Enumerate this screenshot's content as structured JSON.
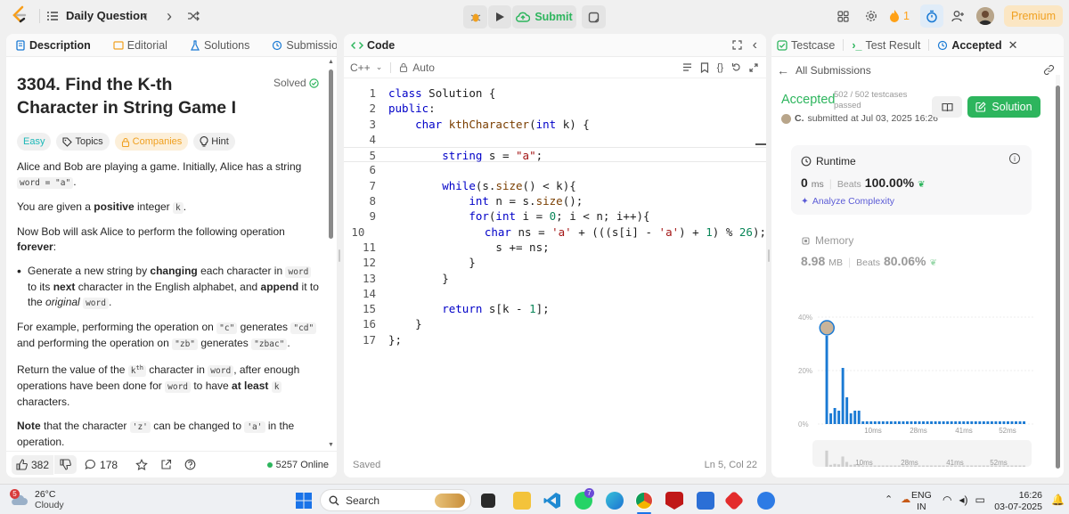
{
  "topbar": {
    "title": "Daily Question",
    "submit_label": "Submit",
    "streak": "1",
    "premium_label": "Premium"
  },
  "left": {
    "tabs": [
      "Description",
      "Editorial",
      "Solutions",
      "Submissions"
    ],
    "problem_title": "3304. Find the K-th Character in String Game I",
    "solved_label": "Solved",
    "tags": [
      "Easy",
      "Topics",
      "Companies",
      "Hint"
    ],
    "description": {
      "p1_a": "Alice and Bob are playing a game. Initially, Alice has a string ",
      "p1_code": "word = \"a\"",
      "p1_b": ".",
      "p2_a": "You are given a ",
      "p2_bold": "positive",
      "p2_b": " integer ",
      "p2_code": "k",
      "p2_c": ".",
      "p3_a": "Now Bob will ask Alice to perform the following operation ",
      "p3_bold": "forever",
      "p3_b": ":",
      "b1_a": "Generate a new string by ",
      "b1_bold1": "changing",
      "b1_b": " each character in ",
      "b1_code": "word",
      "b1_c": " to its ",
      "b1_bold2": "next",
      "b1_d": " character in the English alphabet, and ",
      "b1_bold3": "append",
      "b1_e": " it to the ",
      "b1_em": "original",
      "b1_code2": "word",
      "b1_f": ".",
      "p4_a": "For example, performing the operation on ",
      "p4_code1": "\"c\"",
      "p4_b": " generates ",
      "p4_code2": "\"cd\"",
      "p4_c": " and performing the operation on ",
      "p4_code3": "\"zb\"",
      "p4_d": " generates ",
      "p4_code4": "\"zbac\"",
      "p4_e": ".",
      "p5_a": "Return the value of the ",
      "p5_k": "k",
      "p5_sup": "th",
      "p5_b": " character in ",
      "p5_code1": "word",
      "p5_c": ", after enough operations have been done for ",
      "p5_code2": "word",
      "p5_d": " to have ",
      "p5_bold": "at least",
      "p5_code3": "k",
      "p5_e": " characters.",
      "p6_bold": "Note",
      "p6_a": " that the character ",
      "p6_code1": "'z'",
      "p6_b": " can be changed to ",
      "p6_code2": "'a'",
      "p6_c": " in the operation."
    },
    "likes": "382",
    "comments": "178",
    "online": "5257 Online"
  },
  "code": {
    "tab_label": "Code",
    "language": "C++",
    "auto_label": "Auto",
    "lines": [
      "class Solution {",
      "public:",
      "    char kthCharacter(int k) {",
      "",
      "        string s = \"a\";",
      "",
      "        while(s.size() < k){",
      "            int n = s.size();",
      "            for(int i = 0; i < n; i++){",
      "                char ns = 'a' + (((s[i] - 'a') + 1) % 26);",
      "                s += ns;",
      "            }",
      "        }",
      "",
      "        return s[k - 1];",
      "    }",
      "};"
    ],
    "status": "Saved",
    "cursor": "Ln 5, Col 22"
  },
  "right": {
    "tabs": [
      "Testcase",
      "Test Result",
      "Accepted"
    ],
    "all_submissions": "All Submissions",
    "accepted": "Accepted",
    "testcases": "502 / 502 testcases passed",
    "user": "C.",
    "submitted_at": "submitted at Jul 03, 2025 16:26",
    "solution_label": "Solution",
    "runtime_label": "Runtime",
    "runtime_value": "0",
    "runtime_unit": "ms",
    "beats_label": "Beats",
    "runtime_beats": "100.00%",
    "analyze_label": "Analyze Complexity",
    "memory_label": "Memory",
    "memory_value": "8.98",
    "memory_unit": "MB",
    "memory_beats": "80.06%"
  },
  "chart_data": {
    "type": "bar",
    "y_ticks": [
      "40%",
      "20%",
      "0%"
    ],
    "x_ticks": [
      "10ms",
      "28ms",
      "41ms",
      "52ms"
    ],
    "ylim": [
      0,
      40
    ],
    "values": [
      33,
      4,
      6,
      5,
      21,
      10,
      4,
      5,
      5,
      1,
      1,
      1,
      1,
      1,
      1,
      1,
      1,
      1,
      1,
      1,
      1,
      1,
      1,
      1,
      1,
      1,
      1,
      1,
      1,
      1,
      1,
      1,
      1,
      1,
      1,
      1,
      1,
      1,
      1,
      1,
      1,
      1,
      1,
      1,
      1,
      1,
      1,
      1,
      1,
      1
    ],
    "highlight_index": 0
  },
  "taskbar": {
    "weather_temp": "26°C",
    "weather_desc": "Cloudy",
    "weather_badge": "5",
    "search_label": "Search",
    "lang": "ENG",
    "region": "IN",
    "time": "16:26",
    "date": "03-07-2025",
    "whatsapp_badge": "7"
  }
}
